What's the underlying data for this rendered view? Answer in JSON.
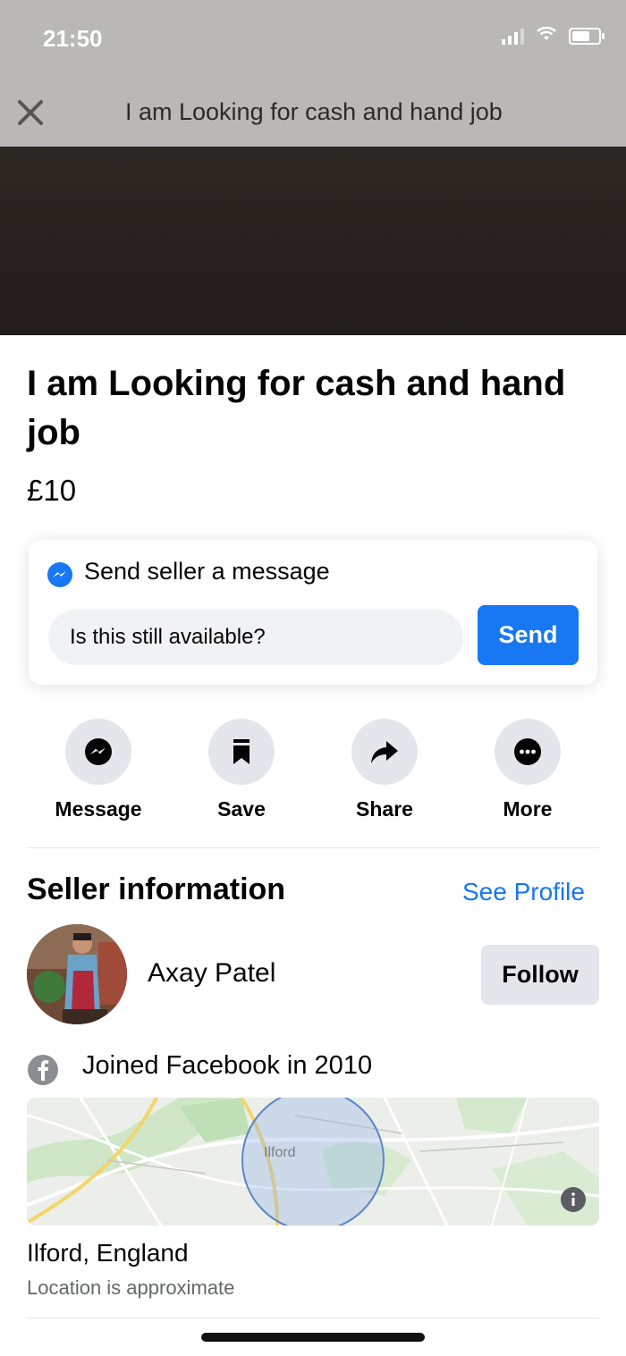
{
  "status_bar": {
    "time": "21:50"
  },
  "nav": {
    "title": "I am Looking for cash and hand job"
  },
  "listing": {
    "title": "I am Looking for cash and hand job",
    "price": "£10"
  },
  "message_card": {
    "heading": "Send seller a message",
    "input_value": "Is this still available?",
    "send_label": "Send"
  },
  "actions": [
    {
      "label": "Message",
      "icon": "messenger-icon"
    },
    {
      "label": "Save",
      "icon": "bookmark-icon"
    },
    {
      "label": "Share",
      "icon": "share-arrow-icon"
    },
    {
      "label": "More",
      "icon": "more-dots-icon"
    }
  ],
  "seller": {
    "section_title": "Seller information",
    "see_profile": "See Profile",
    "name": "Axay Patel",
    "follow_label": "Follow",
    "joined": "Joined Facebook in 2010"
  },
  "location": {
    "map_label": "Ilford",
    "name": "Ilford, England",
    "note": "Location is approximate"
  },
  "colors": {
    "accent": "#1877f2",
    "header_bg": "#b9b8b6",
    "button_gray": "#e4e6eb"
  }
}
